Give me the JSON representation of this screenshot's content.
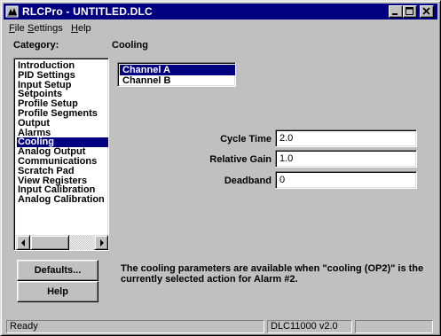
{
  "window": {
    "title": "RLCPro - UNTITLED.DLC",
    "controls": {
      "minimize": "minimize-icon",
      "maximize": "maximize-icon",
      "close": "close-icon"
    }
  },
  "menu": [
    {
      "label": "File",
      "mnemonic": "F",
      "rest": "ile"
    },
    {
      "label": "Settings",
      "mnemonic": "S",
      "rest": "ettings"
    },
    {
      "label": "Help",
      "mnemonic": "H",
      "rest": "elp"
    }
  ],
  "category": {
    "label": "Category:",
    "items": [
      "Introduction",
      "PID Settings",
      "Input Setup",
      "Setpoints",
      "Profile Setup",
      "Profile Segments",
      "Output",
      "Alarms",
      "Cooling",
      "Analog Output",
      "Communications",
      "Scratch Pad",
      "View Registers",
      "Input Calibration",
      "Analog Calibration"
    ],
    "selected": "Cooling"
  },
  "panel": {
    "title": "Cooling",
    "channels": [
      "Channel A",
      "Channel B"
    ],
    "selected_channel": "Channel A",
    "fields": [
      {
        "label": "Cycle Time",
        "value": "2.0"
      },
      {
        "label": "Relative Gain",
        "value": "1.0"
      },
      {
        "label": "Deadband",
        "value": "0"
      }
    ],
    "info": "The cooling parameters are available when \"cooling (OP2)\" is the currently selected action for Alarm #2."
  },
  "buttons": {
    "defaults": "Defaults...",
    "help": "Help"
  },
  "status": {
    "left": "Ready",
    "version": "DLC11000 v2.0",
    "extra": ""
  },
  "colors": {
    "titlebar": "#000080",
    "selection": "#000080",
    "face": "#c0c0c0"
  }
}
